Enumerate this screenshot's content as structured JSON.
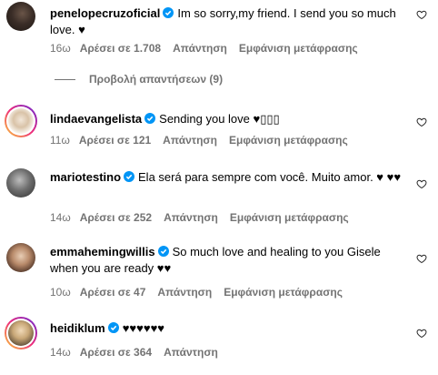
{
  "labels": {
    "likes_prefix": "Αρέσει σε",
    "reply": "Απάντηση",
    "see_translation": "Εμφάνιση μετάφρασης"
  },
  "comments": [
    {
      "username": "penelopecruzoficial",
      "text": "Im so sorry,my friend. I send you so much love. ♥",
      "time": "16ω",
      "likes": "Αρέσει σε 1.708",
      "reply": "Απάντηση",
      "translate": "Εμφάνιση μετάφρασης",
      "view_replies": "Προβολή απαντήσεων (9)"
    },
    {
      "username": "lindaevangelista",
      "text": "Sending you love ♥▯▯▯",
      "time": "11ω",
      "likes": "Αρέσει σε 121",
      "reply": "Απάντηση",
      "translate": "Εμφάνιση μετάφρασης"
    },
    {
      "username": "mariotestino",
      "text": "Ela será para sempre com você. Muito amor. ♥ ♥♥",
      "time": "14ω",
      "likes": "Αρέσει σε 252",
      "reply": "Απάντηση",
      "translate": "Εμφάνιση μετάφρασης"
    },
    {
      "username": "emmahemingwillis",
      "text": "So much love and healing to you Gisele when you are ready ♥♥",
      "time": "10ω",
      "likes": "Αρέσει σε 47",
      "reply": "Απάντηση",
      "translate": "Εμφάνιση μετάφρασης"
    },
    {
      "username": "heidiklum",
      "text": "♥♥♥♥♥♥",
      "time": "14ω",
      "likes": "Αρέσει σε 364",
      "reply": "Απάντηση"
    }
  ],
  "colors": {
    "verified": "#0095f6",
    "meta": "#737373"
  }
}
